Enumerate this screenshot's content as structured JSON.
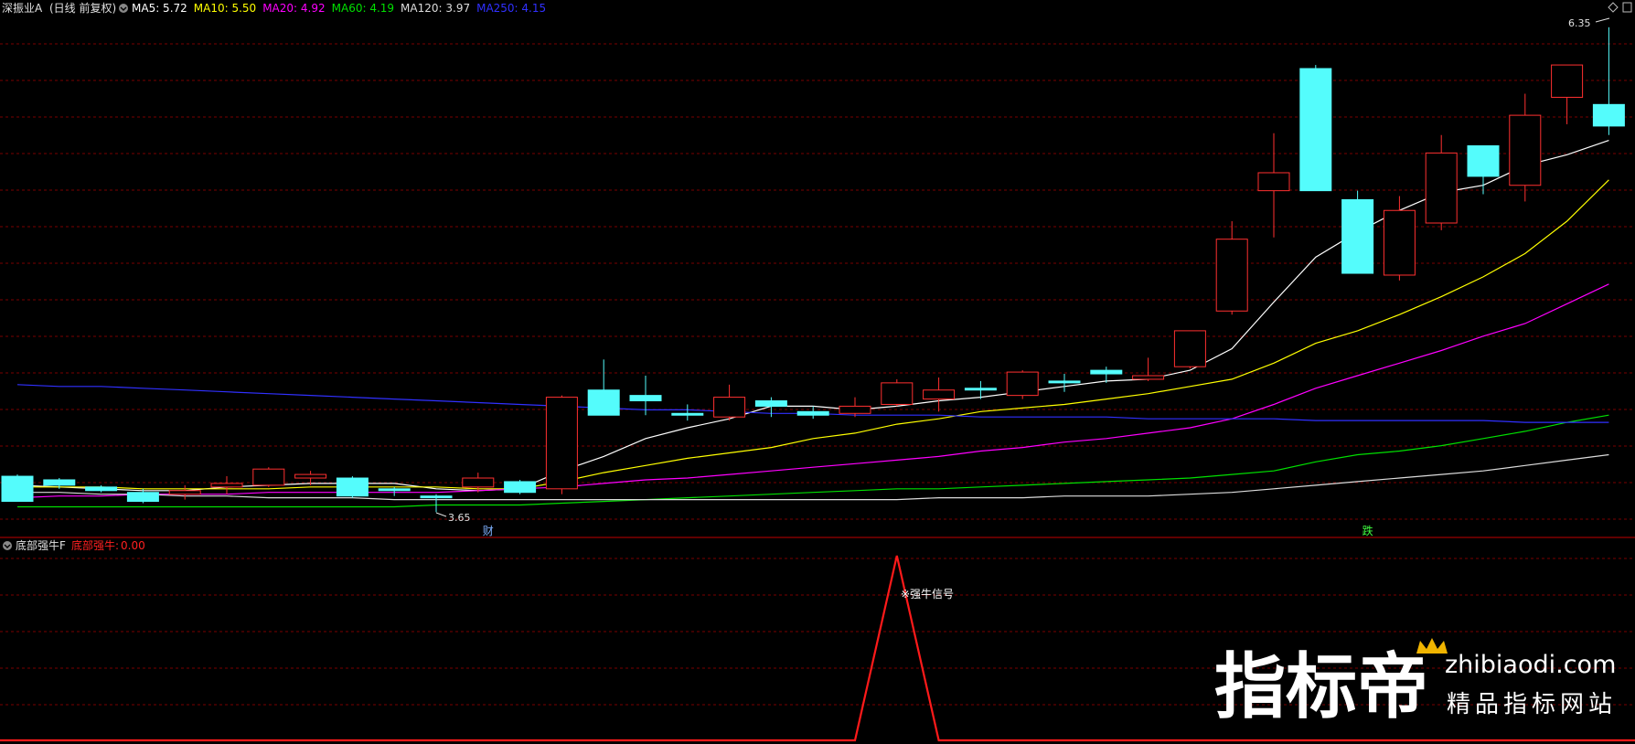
{
  "main_panel": {
    "stock_name": "深振业A",
    "period": "(日线 前复权)",
    "ma_indicators": [
      {
        "label": "MA5:",
        "value": "5.72",
        "color": "#ffffff"
      },
      {
        "label": "MA10:",
        "value": "5.50",
        "color": "#ffff00"
      },
      {
        "label": "MA20:",
        "value": "4.92",
        "color": "#ff00ff"
      },
      {
        "label": "MA60:",
        "value": "4.19",
        "color": "#00e000"
      },
      {
        "label": "MA120:",
        "value": "3.97",
        "color": "#dcdcdc"
      },
      {
        "label": "MA250:",
        "value": "4.15",
        "color": "#3030ff"
      }
    ],
    "high_marker": "6.35",
    "low_marker": "3.65",
    "event_markers": [
      {
        "label": "财",
        "color": "#7fb2ff",
        "index": 11
      },
      {
        "label": "跌",
        "color": "#40ff40",
        "index": 32
      }
    ]
  },
  "sub_panel": {
    "indicator_name": "底部强牛F",
    "value_label": "底部强牛:",
    "value": "0.00",
    "annotation": "※强牛信号"
  },
  "watermark": {
    "brand_cn": "指标帝",
    "domain": "zhibiaodi.com",
    "slogan": "精品指标网站"
  },
  "colors": {
    "up": "#ff3030",
    "down": "#54fcfc",
    "grid": "#7a0000",
    "signal": "#ff1a1a"
  },
  "chart_data": {
    "type": "candlestick",
    "ylim": [
      3.55,
      6.4
    ],
    "candles": [
      {
        "o": 3.85,
        "h": 3.86,
        "l": 3.76,
        "c": 3.71
      },
      {
        "o": 3.83,
        "h": 3.84,
        "l": 3.78,
        "c": 3.8
      },
      {
        "o": 3.79,
        "h": 3.8,
        "l": 3.76,
        "c": 3.77
      },
      {
        "o": 3.76,
        "h": 3.78,
        "l": 3.7,
        "c": 3.71
      },
      {
        "o": 3.75,
        "h": 3.8,
        "l": 3.72,
        "c": 3.77
      },
      {
        "o": 3.79,
        "h": 3.85,
        "l": 3.75,
        "c": 3.81
      },
      {
        "o": 3.8,
        "h": 3.9,
        "l": 3.79,
        "c": 3.89
      },
      {
        "o": 3.84,
        "h": 3.88,
        "l": 3.8,
        "c": 3.86
      },
      {
        "o": 3.84,
        "h": 3.85,
        "l": 3.73,
        "c": 3.74
      },
      {
        "o": 3.78,
        "h": 3.79,
        "l": 3.74,
        "c": 3.77
      },
      {
        "o": 3.74,
        "h": 3.75,
        "l": 3.65,
        "c": 3.73
      },
      {
        "o": 3.79,
        "h": 3.87,
        "l": 3.76,
        "c": 3.84
      },
      {
        "o": 3.82,
        "h": 3.83,
        "l": 3.75,
        "c": 3.76
      },
      {
        "o": 3.78,
        "h": 4.3,
        "l": 3.75,
        "c": 4.29
      },
      {
        "o": 4.33,
        "h": 4.5,
        "l": 4.23,
        "c": 4.19
      },
      {
        "o": 4.3,
        "h": 4.41,
        "l": 4.19,
        "c": 4.27
      },
      {
        "o": 4.2,
        "h": 4.25,
        "l": 4.16,
        "c": 4.19
      },
      {
        "o": 4.18,
        "h": 4.36,
        "l": 4.16,
        "c": 4.29
      },
      {
        "o": 4.27,
        "h": 4.29,
        "l": 4.18,
        "c": 4.24
      },
      {
        "o": 4.21,
        "h": 4.24,
        "l": 4.17,
        "c": 4.19
      },
      {
        "o": 4.2,
        "h": 4.29,
        "l": 4.18,
        "c": 4.24
      },
      {
        "o": 4.25,
        "h": 4.39,
        "l": 4.24,
        "c": 4.37
      },
      {
        "o": 4.28,
        "h": 4.4,
        "l": 4.21,
        "c": 4.33
      },
      {
        "o": 4.34,
        "h": 4.38,
        "l": 4.28,
        "c": 4.33
      },
      {
        "o": 4.3,
        "h": 4.44,
        "l": 4.28,
        "c": 4.43
      },
      {
        "o": 4.38,
        "h": 4.42,
        "l": 4.32,
        "c": 4.37
      },
      {
        "o": 4.44,
        "h": 4.46,
        "l": 4.37,
        "c": 4.42
      },
      {
        "o": 4.39,
        "h": 4.51,
        "l": 4.38,
        "c": 4.41
      },
      {
        "o": 4.46,
        "h": 4.66,
        "l": 4.45,
        "c": 4.66
      },
      {
        "o": 4.77,
        "h": 5.27,
        "l": 4.75,
        "c": 5.17
      },
      {
        "o": 5.44,
        "h": 5.76,
        "l": 5.18,
        "c": 5.54
      },
      {
        "o": 6.12,
        "h": 6.14,
        "l": 5.44,
        "c": 5.44
      },
      {
        "o": 5.39,
        "h": 5.44,
        "l": 4.98,
        "c": 4.98
      },
      {
        "o": 4.97,
        "h": 5.41,
        "l": 4.94,
        "c": 5.33
      },
      {
        "o": 5.26,
        "h": 5.75,
        "l": 5.22,
        "c": 5.65
      },
      {
        "o": 5.69,
        "h": 5.69,
        "l": 5.42,
        "c": 5.52
      },
      {
        "o": 5.47,
        "h": 5.98,
        "l": 5.38,
        "c": 5.86
      },
      {
        "o": 5.96,
        "h": 6.12,
        "l": 5.81,
        "c": 6.14
      },
      {
        "o": 5.92,
        "h": 6.35,
        "l": 5.75,
        "c": 5.8
      }
    ],
    "ma_series": [
      {
        "name": "MA5",
        "color": "#ffffff",
        "values": [
          3.8,
          3.79,
          3.78,
          3.77,
          3.77,
          3.79,
          3.8,
          3.81,
          3.81,
          3.81,
          3.78,
          3.77,
          3.78,
          3.88,
          3.96,
          4.06,
          4.12,
          4.17,
          4.24,
          4.24,
          4.22,
          4.24,
          4.27,
          4.29,
          4.32,
          4.35,
          4.38,
          4.39,
          4.44,
          4.56,
          4.82,
          5.07,
          5.21,
          5.33,
          5.43,
          5.47,
          5.58,
          5.64,
          5.72
        ]
      },
      {
        "name": "MA10",
        "color": "#ffff00",
        "values": [
          3.79,
          3.79,
          3.79,
          3.78,
          3.78,
          3.78,
          3.78,
          3.79,
          3.79,
          3.79,
          3.79,
          3.78,
          3.78,
          3.82,
          3.87,
          3.91,
          3.95,
          3.98,
          4.01,
          4.06,
          4.09,
          4.14,
          4.17,
          4.21,
          4.23,
          4.25,
          4.28,
          4.31,
          4.35,
          4.39,
          4.48,
          4.59,
          4.66,
          4.75,
          4.85,
          4.96,
          5.09,
          5.27,
          5.5
        ]
      },
      {
        "name": "MA20",
        "color": "#ff00ff",
        "values": [
          3.73,
          3.74,
          3.74,
          3.75,
          3.75,
          3.75,
          3.76,
          3.76,
          3.76,
          3.76,
          3.76,
          3.77,
          3.78,
          3.79,
          3.81,
          3.83,
          3.84,
          3.86,
          3.88,
          3.9,
          3.92,
          3.94,
          3.96,
          3.99,
          4.01,
          4.04,
          4.06,
          4.09,
          4.12,
          4.17,
          4.25,
          4.34,
          4.41,
          4.48,
          4.55,
          4.63,
          4.7,
          4.81,
          4.92
        ]
      },
      {
        "name": "MA60",
        "color": "#00e000",
        "values": [
          3.68,
          3.68,
          3.68,
          3.68,
          3.68,
          3.68,
          3.68,
          3.68,
          3.68,
          3.68,
          3.69,
          3.69,
          3.69,
          3.7,
          3.71,
          3.72,
          3.73,
          3.74,
          3.75,
          3.76,
          3.77,
          3.78,
          3.78,
          3.79,
          3.8,
          3.81,
          3.82,
          3.83,
          3.84,
          3.86,
          3.88,
          3.93,
          3.97,
          3.99,
          4.02,
          4.06,
          4.1,
          4.15,
          4.19
        ]
      },
      {
        "name": "MA120",
        "color": "#dcdcdc",
        "values": [
          3.76,
          3.76,
          3.75,
          3.75,
          3.74,
          3.74,
          3.73,
          3.73,
          3.73,
          3.72,
          3.72,
          3.72,
          3.72,
          3.72,
          3.72,
          3.72,
          3.72,
          3.72,
          3.72,
          3.72,
          3.72,
          3.72,
          3.73,
          3.73,
          3.73,
          3.74,
          3.74,
          3.74,
          3.75,
          3.76,
          3.78,
          3.8,
          3.82,
          3.84,
          3.86,
          3.88,
          3.91,
          3.94,
          3.97
        ]
      },
      {
        "name": "MA250",
        "color": "#3030ff",
        "values": [
          4.36,
          4.35,
          4.35,
          4.34,
          4.33,
          4.32,
          4.31,
          4.3,
          4.29,
          4.28,
          4.27,
          4.26,
          4.25,
          4.24,
          4.23,
          4.22,
          4.22,
          4.21,
          4.2,
          4.2,
          4.19,
          4.19,
          4.19,
          4.18,
          4.18,
          4.18,
          4.18,
          4.17,
          4.17,
          4.17,
          4.17,
          4.16,
          4.16,
          4.16,
          4.16,
          4.16,
          4.15,
          4.15,
          4.15
        ]
      }
    ],
    "sub_indicator": {
      "name": "底部强牛",
      "color": "#ff1a1a",
      "ylim": [
        0,
        1
      ],
      "values": [
        0,
        0,
        0,
        0,
        0,
        0,
        0,
        0,
        0,
        0,
        0,
        0,
        0,
        0,
        0,
        0,
        0,
        0,
        0,
        0,
        0,
        1,
        0,
        0,
        0,
        0,
        0,
        0,
        0,
        0,
        0,
        0,
        0,
        0,
        0,
        0,
        0,
        0,
        0
      ]
    }
  }
}
